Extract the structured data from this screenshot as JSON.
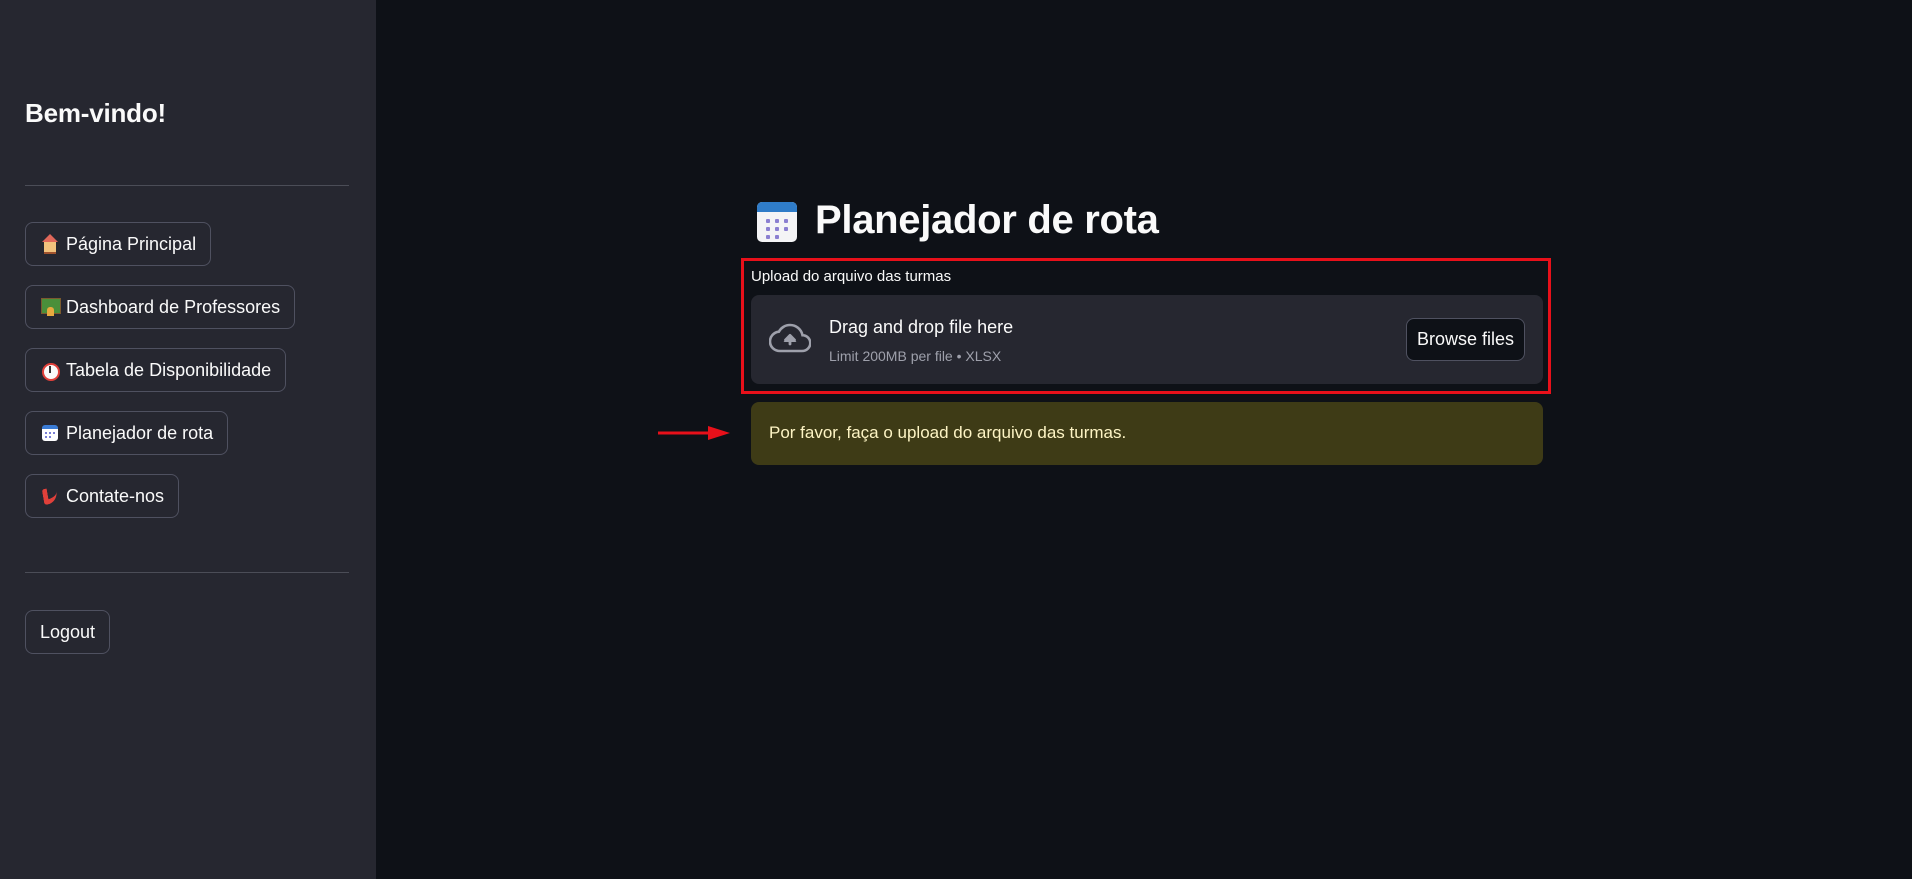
{
  "sidebar": {
    "welcome": "Bem-vindo!",
    "nav": [
      {
        "label": "Página Principal",
        "icon": "house-icon"
      },
      {
        "label": "Dashboard de Professores",
        "icon": "teacher-icon"
      },
      {
        "label": "Tabela de Disponibilidade",
        "icon": "alarm-clock-icon"
      },
      {
        "label": "Planejador de rota",
        "icon": "calendar-icon"
      },
      {
        "label": "Contate-nos",
        "icon": "phone-icon"
      }
    ],
    "logout": "Logout"
  },
  "main": {
    "title": "Planejador de rota",
    "title_icon": "calendar-icon",
    "uploader": {
      "label": "Upload do arquivo das turmas",
      "drop_text": "Drag and drop file here",
      "limit_text": "Limit 200MB per file • XLSX",
      "browse_label": "Browse files",
      "icon": "cloud-upload-icon"
    },
    "warning": {
      "text": "Por favor, faça o upload do arquivo das turmas."
    }
  },
  "annotations": {
    "highlight_color": "#e8101a",
    "arrow_color": "#e8101a"
  },
  "colors": {
    "background": "#0e1117",
    "sidebar": "#262730",
    "warning_bg": "#3e3b16",
    "warning_text": "#fdf4c4"
  }
}
